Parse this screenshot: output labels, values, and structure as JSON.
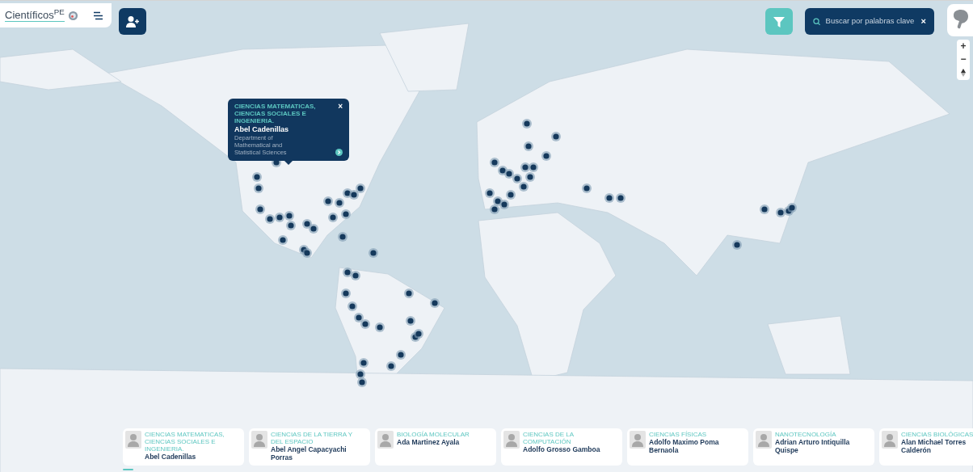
{
  "header": {
    "logo": "Científicos$^{PE}$"
  },
  "search": {
    "placeholder": "Buscar por palabras clave",
    "clear": "×"
  },
  "zoom_controls": [
    "+",
    "−"
  ],
  "popup": {
    "category": "CIENCIAS MATEMATICAS, CIENCIAS SOCIALES E INGENIERIA.",
    "name": "Abel Cadenillas",
    "affiliation": "Department of Mathematical and Statistical Sciences",
    "close": "×"
  },
  "cards": [
    {
      "category": "CIENCIAS MATEMATICAS, CIENCIAS SOCIALES E INGENIERIA.",
      "name": "Abel Cadenillas"
    },
    {
      "category": "CIENCIAS DE LA TIERRA Y DEL ESPACIO",
      "name": "Abel Angel Capacyachi Porras"
    },
    {
      "category": "BIOLOGÍA MOLECULAR",
      "name": "Ada Martinez Ayala"
    },
    {
      "category": "CIENCIAS DE LA COMPUTACIÓN",
      "name": "Adolfo Grosso Gamboa"
    },
    {
      "category": "CIENCIAS FÍSICAS",
      "name": "Adolfo Maximo Poma Bernaola"
    },
    {
      "category": "NANOTECNOLOGÍA",
      "name": "Adrian Arturo Intiquilla Quispe"
    },
    {
      "category": "CIENCIAS BIOLÓGICAS",
      "name": "Alan Michael Torres Calderón"
    }
  ]
}
